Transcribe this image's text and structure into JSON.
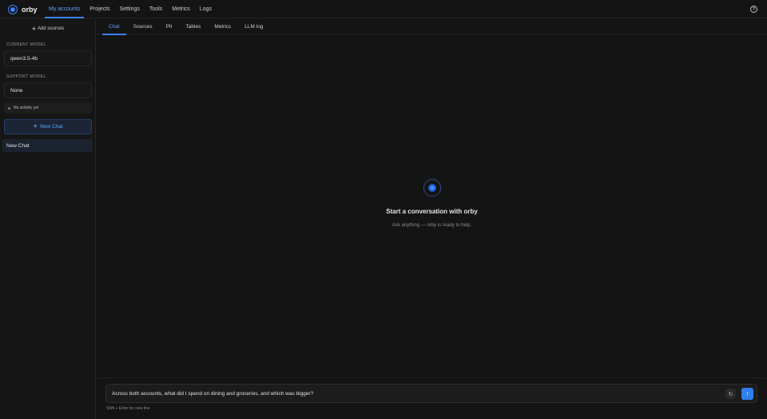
{
  "app": {
    "name": "orby"
  },
  "nav": {
    "items": [
      {
        "label": "My accounts",
        "active": true
      },
      {
        "label": "Projects"
      },
      {
        "label": "Settings"
      },
      {
        "label": "Tools"
      },
      {
        "label": "Metrics"
      },
      {
        "label": "Logs"
      }
    ],
    "help_icon": "?"
  },
  "sidebar": {
    "add_sources_label": "Add sources",
    "current_model_label": "CURRENT MODEL",
    "current_model_value": "qwen3.5-4b",
    "support_model_label": "SUPPORT MODEL",
    "support_model_value": "None",
    "activity_text": "No activity yet",
    "new_chat_button": "New Chat",
    "chats": [
      {
        "label": "New Chat",
        "selected": true
      }
    ]
  },
  "main": {
    "tabs": [
      {
        "label": "Chat",
        "active": true
      },
      {
        "label": "Sources"
      },
      {
        "label": "PII"
      },
      {
        "label": "Tables"
      },
      {
        "label": "Metrics"
      },
      {
        "label": "LLM log"
      }
    ],
    "empty_state": {
      "title": "Start a conversation with orby",
      "subtitle": "Ask anything — orby is ready to help."
    },
    "composer": {
      "value": "Across both accounts, what did I spend on dining and groceries, and which was bigger?",
      "hint": "Shift + Enter for new line"
    }
  },
  "colors": {
    "accent": "#3b82f6",
    "background": "#141414",
    "send": "#2f80ed"
  }
}
